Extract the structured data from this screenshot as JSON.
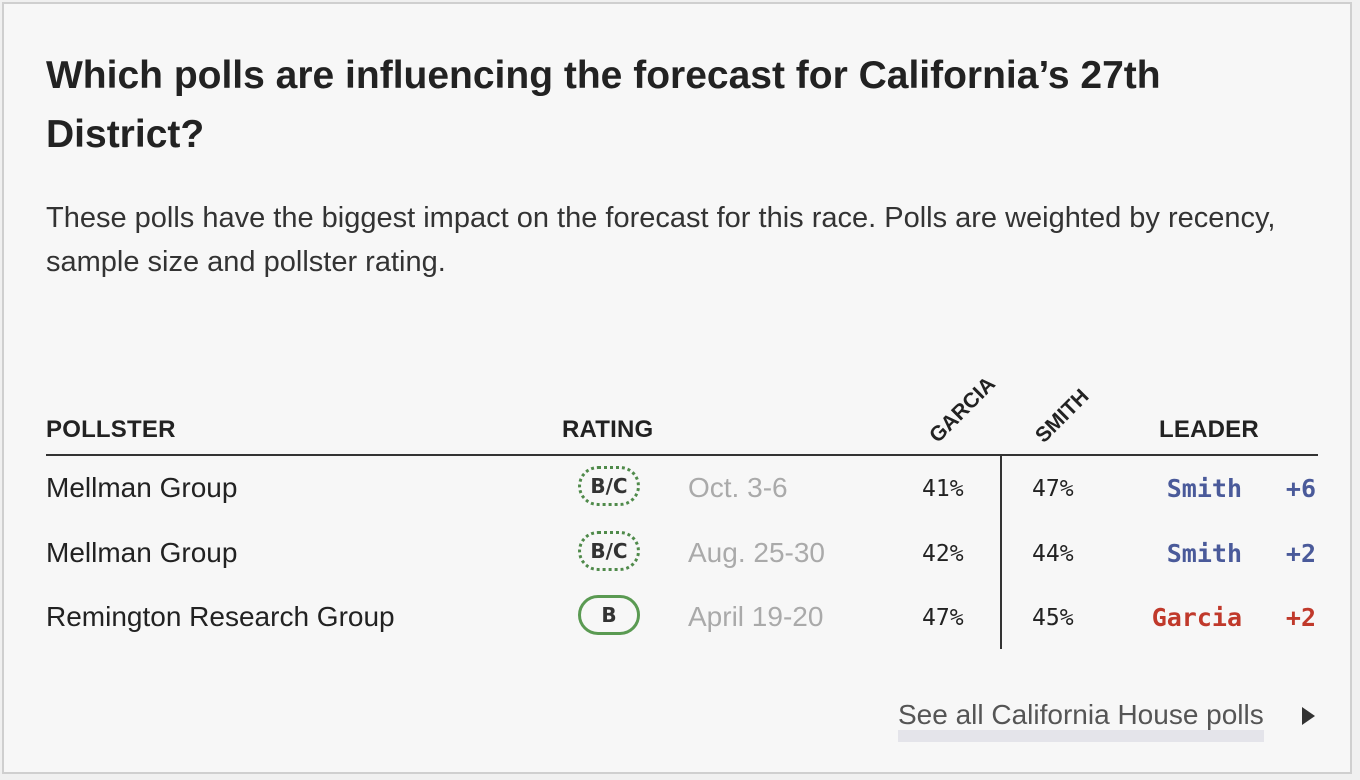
{
  "title": "Which polls are influencing the forecast for California’s 27th District?",
  "subtitle": "These polls have the biggest impact on the forecast for this race. Polls are weighted by recency, sample size and pollster rating.",
  "headers": {
    "pollster": "POLLSTER",
    "rating": "RATING",
    "garcia": "GARCIA",
    "smith": "SMITH",
    "leader": "LEADER"
  },
  "rows": [
    {
      "pollster": "Mellman Group",
      "rating": "B/C",
      "rating_style": "dotted",
      "dates": "Oct. 3-6",
      "garcia": "41%",
      "smith": "47%",
      "leader": "Smith",
      "margin": "+6",
      "leader_color": "#4a5a9a"
    },
    {
      "pollster": "Mellman Group",
      "rating": "B/C",
      "rating_style": "dotted",
      "dates": "Aug. 25-30",
      "garcia": "42%",
      "smith": "44%",
      "leader": "Smith",
      "margin": "+2",
      "leader_color": "#4a5a9a"
    },
    {
      "pollster": "Remington Research Group",
      "rating": "B",
      "rating_style": "solid",
      "dates": "April 19-20",
      "garcia": "47%",
      "smith": "45%",
      "leader": "Garcia",
      "margin": "+2",
      "leader_color": "#c0392b"
    }
  ],
  "footer": {
    "link_text": "See all California House polls",
    "icon": "arrow-right-icon"
  },
  "colors": {
    "smith": "#4a5a9a",
    "garcia": "#c0392b",
    "rating_border": "#4f8a4a"
  }
}
